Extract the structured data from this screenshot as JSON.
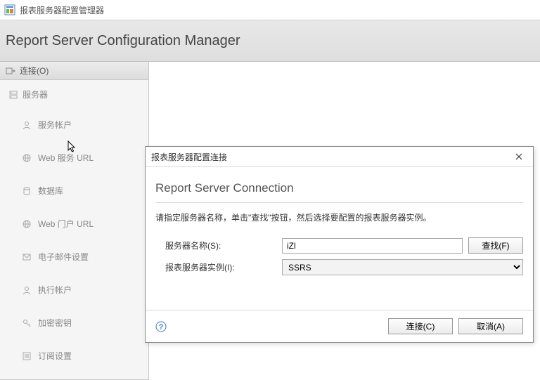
{
  "app": {
    "title": "报表服务器配置管理器"
  },
  "banner": {
    "title": "Report Server Configuration Manager"
  },
  "sidebar": {
    "connect_label": "连接(O)",
    "server_root": "服务器",
    "items": [
      {
        "label": "服务帐户"
      },
      {
        "label": "Web 服务 URL"
      },
      {
        "label": "数据库"
      },
      {
        "label": "Web 门户 URL"
      },
      {
        "label": "电子邮件设置"
      },
      {
        "label": "执行帐户"
      },
      {
        "label": "加密密钥"
      },
      {
        "label": "订阅设置"
      }
    ]
  },
  "dialog": {
    "title": "报表服务器配置连接",
    "heading": "Report Server Connection",
    "instruction": "请指定服务器名称，单击\"查找\"按钮，然后选择要配置的报表服务器实例。",
    "server_name_label": "服务器名称(S):",
    "server_name_value": "iZl",
    "instance_label": "报表服务器实例(I):",
    "instance_value": "SSRS",
    "find_label": "查找(F)",
    "connect_label": "连接(C)",
    "cancel_label": "取消(A)"
  }
}
